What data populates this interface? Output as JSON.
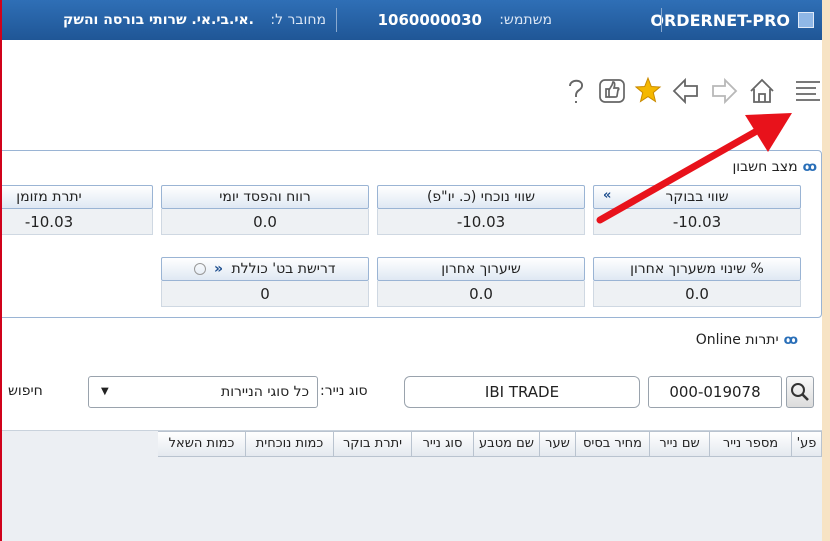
{
  "titlebar": {
    "app_name": "ORDERNET-PRO",
    "user_label": "משתמש:",
    "user_value": "1060000030",
    "connected_label": "מחובר ל:",
    "connected_value": ".אי.בי.אי. שרותי בורסה והשק"
  },
  "toolbar": {
    "icons": [
      "menu-icon",
      "home-icon",
      "forward-icon",
      "back-icon",
      "star-icon",
      "thumbs-up-icon",
      "help-icon"
    ]
  },
  "account": {
    "title": "מצב חשבון",
    "metrics": [
      {
        "label": "שווי בבוקר",
        "value": "-10.03"
      },
      {
        "label": "שווי נוכחי (כ. יו\"פ)",
        "value": "-10.03"
      },
      {
        "label": "רווח והפסד יומי",
        "value": "0.0"
      },
      {
        "label": "יתרת מזומן",
        "value": "-10.03"
      },
      {
        "label": "% שינוי משערוך אחרון",
        "value": "0.0"
      },
      {
        "label": "שיערוך אחרון",
        "value": "0.0"
      },
      {
        "label": "דרישת בט' כוללת",
        "value": "0"
      }
    ],
    "double_chevron": "«"
  },
  "online": {
    "title": "יתרות Online",
    "account_number": "000-019078",
    "account_name": "IBI TRADE",
    "security_type_label": "סוג נייר:",
    "security_type_value": "כל סוגי הניירות",
    "search_label": "חיפוש"
  },
  "table": {
    "headers": [
      "פע'",
      "מספר נייר",
      "שם נייר",
      "מחיר בסיס",
      "שער",
      "שם מטבע",
      "סוג נייר",
      "יתרת בוקר",
      "כמות נוכחית",
      "כמות השאל"
    ]
  },
  "colors": {
    "titlebar": "#1f5696",
    "accent": "#2a6fb8",
    "arrow": "#e8121b",
    "page_bg": "#f7e3c4"
  }
}
